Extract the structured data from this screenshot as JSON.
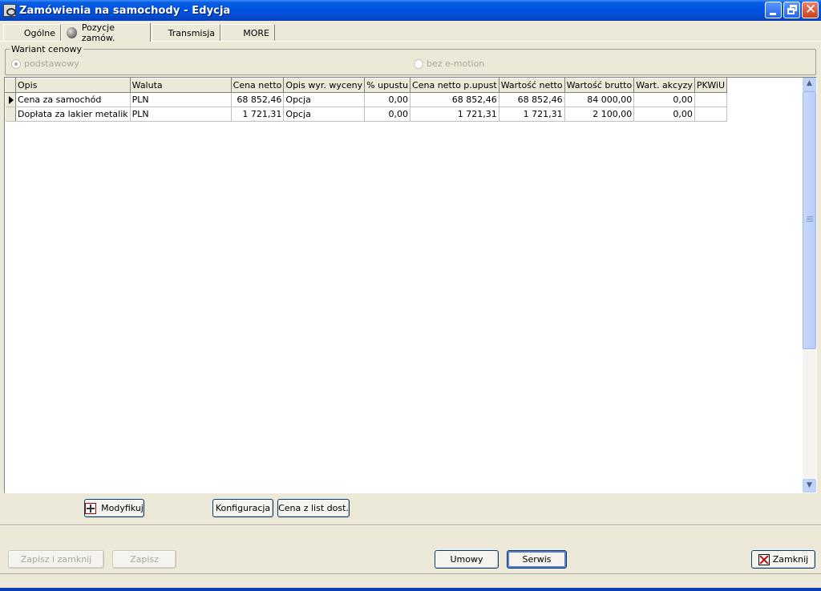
{
  "window": {
    "title": "Zamówienia na samochody - Edycja"
  },
  "tabs": [
    {
      "label": "Ogólne"
    },
    {
      "label": "Pozycje zamów."
    },
    {
      "label": "Transmisja"
    },
    {
      "label": "MORE"
    }
  ],
  "price_variant": {
    "legend": "Wariant cenowy",
    "options": [
      {
        "label": "podstawowy",
        "selected": true
      },
      {
        "label": "bez e-motion",
        "selected": false
      }
    ]
  },
  "grid": {
    "columns": [
      "Opis",
      "Waluta",
      "Cena netto",
      "Opis wyr. wyceny",
      "% upustu",
      "Cena netto p.upust",
      "Wartość netto",
      "Wartość brutto",
      "Wart. akcyzy",
      "PKWiU"
    ],
    "rows": [
      [
        "Cena za samochód",
        "PLN",
        "68 852,46",
        "Opcja",
        "0,00",
        "68 852,46",
        "68 852,46",
        "84 000,00",
        "0,00",
        ""
      ],
      [
        "Dopłata za lakier metalik",
        "PLN",
        "1 721,31",
        "Opcja",
        "0,00",
        "1 721,31",
        "1 721,31",
        "2 100,00",
        "0,00",
        ""
      ]
    ]
  },
  "grid_buttons": {
    "modify": "Modyfikuj",
    "config": "Konfiguracja",
    "price_list": "Cena z list dost."
  },
  "footer_buttons": {
    "save_close": "Zapisz i zamknij",
    "save": "Zapisz",
    "contracts": "Umowy",
    "service": "Serwis",
    "close": "Zamknij"
  },
  "icons": {
    "app": "app-icon",
    "minimize": "minimize-icon",
    "restore": "restore-icon",
    "close": "close-icon",
    "modify": "edit-icon",
    "close_button": "close-x-icon"
  }
}
